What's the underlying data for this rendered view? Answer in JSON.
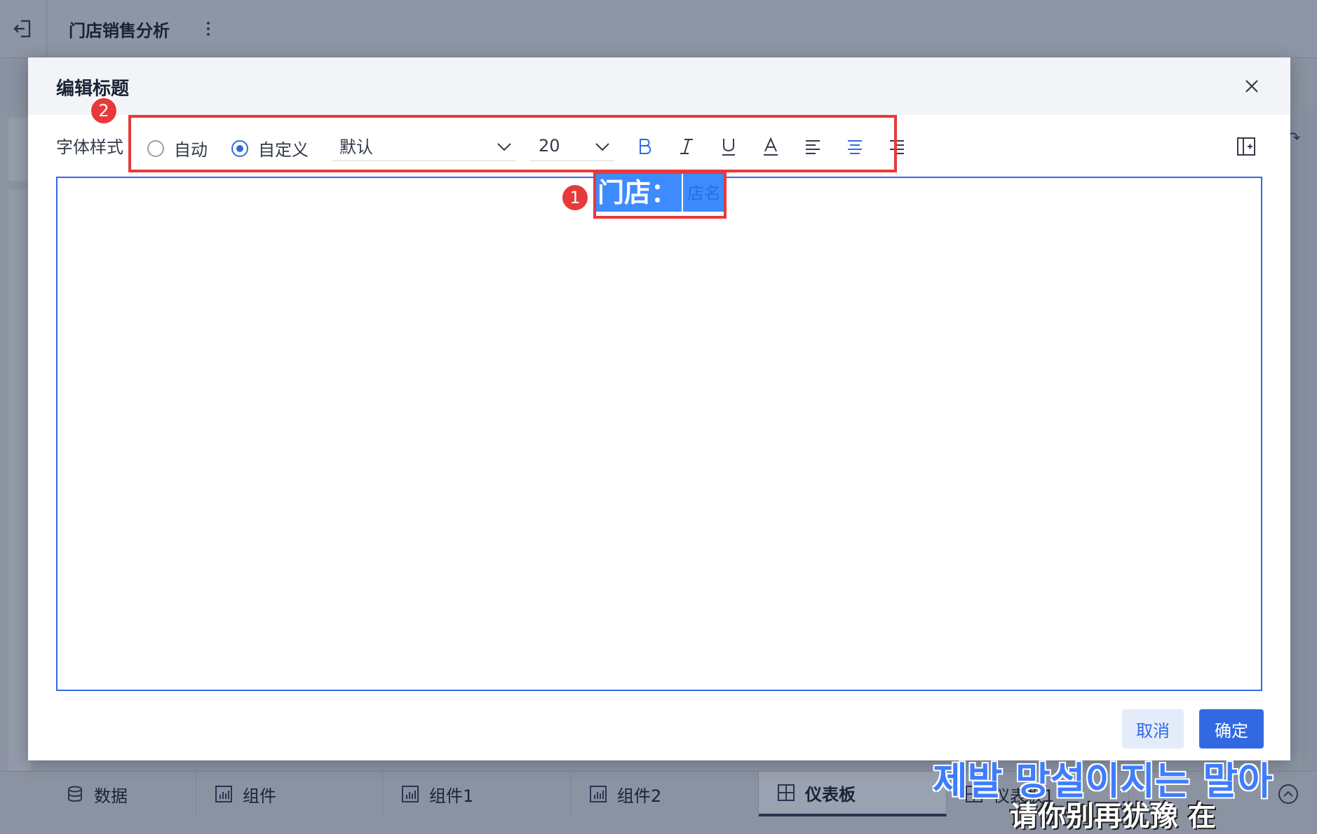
{
  "app": {
    "title": "门店销售分析"
  },
  "bottom_tabs": [
    {
      "label": "数据",
      "icon": "database-icon"
    },
    {
      "label": "组件",
      "icon": "chart-icon"
    },
    {
      "label": "组件1",
      "icon": "chart-icon"
    },
    {
      "label": "组件2",
      "icon": "chart-icon"
    },
    {
      "label": "仪表板",
      "icon": "dashboard-icon",
      "active": true
    },
    {
      "label": "仪表板1",
      "icon": "dashboard-icon"
    }
  ],
  "overlay": {
    "line1": "제발 망설이지는 말아",
    "line2": "请你别再犹豫 在"
  },
  "dialog": {
    "title": "编辑标题",
    "font_style_label": "字体样式",
    "radio_auto": "自动",
    "radio_custom": "自定义",
    "selected_mode": "自定义",
    "font_family": "默认",
    "font_size": "20",
    "title_text": "门店：",
    "title_field": "店名",
    "cancel_label": "取消",
    "ok_label": "确定"
  },
  "markers": {
    "one": "1",
    "two": "2"
  },
  "colors": {
    "accent": "#3269e3",
    "highlight": "#e8393a",
    "selection": "#3d8bff"
  }
}
